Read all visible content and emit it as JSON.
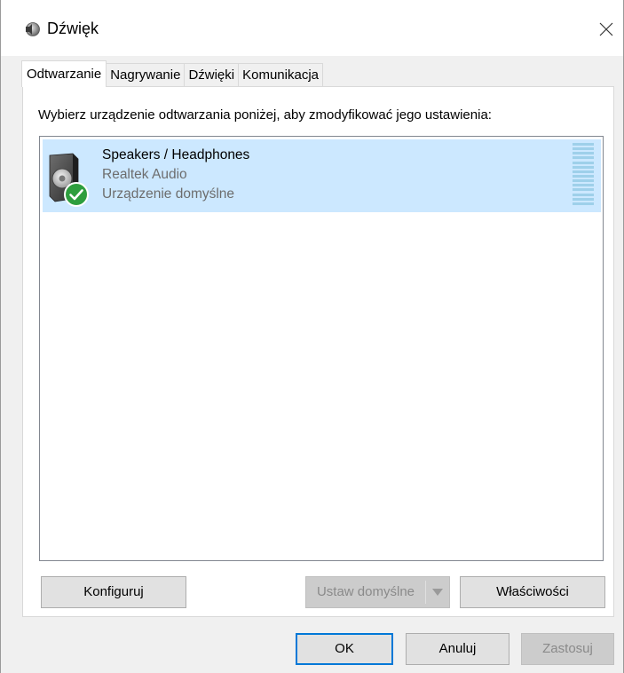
{
  "window": {
    "title": "Dźwięk",
    "icon": "speaker-icon",
    "close_icon": "close-icon"
  },
  "tabs": [
    {
      "label": "Odtwarzanie",
      "active": true
    },
    {
      "label": "Nagrywanie",
      "active": false
    },
    {
      "label": "Dźwięki",
      "active": false
    },
    {
      "label": "Komunikacja",
      "active": false
    }
  ],
  "playback": {
    "instruction": "Wybierz urządzenie odtwarzania poniżej, aby zmodyfikować jego ustawienia:",
    "devices": [
      {
        "name": "Speakers / Headphones",
        "driver": "Realtek Audio",
        "status": "Urządzenie domyślne",
        "icon": "speaker-device-icon",
        "badge_icon": "default-checkmark-icon",
        "selected": true
      }
    ],
    "buttons": {
      "configure": "Konfiguruj",
      "set_default": "Ustaw domyślne",
      "properties": "Właściwości"
    }
  },
  "footer": {
    "ok": "OK",
    "cancel": "Anuluj",
    "apply": "Zastosuj"
  },
  "colors": {
    "selection": "#cce8ff",
    "focus_border": "#0078d7",
    "check_badge": "#2e9e3e"
  }
}
